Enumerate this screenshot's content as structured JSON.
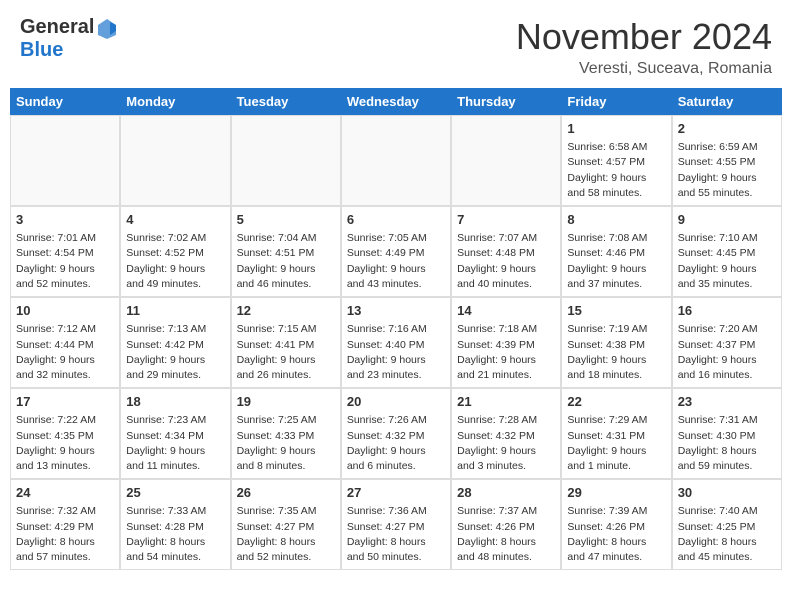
{
  "header": {
    "logo_general": "General",
    "logo_blue": "Blue",
    "month_title": "November 2024",
    "location": "Veresti, Suceava, Romania"
  },
  "calendar": {
    "days_of_week": [
      "Sunday",
      "Monday",
      "Tuesday",
      "Wednesday",
      "Thursday",
      "Friday",
      "Saturday"
    ],
    "weeks": [
      [
        {
          "day": "",
          "info": "",
          "empty": true
        },
        {
          "day": "",
          "info": "",
          "empty": true
        },
        {
          "day": "",
          "info": "",
          "empty": true
        },
        {
          "day": "",
          "info": "",
          "empty": true
        },
        {
          "day": "",
          "info": "",
          "empty": true
        },
        {
          "day": "1",
          "info": "Sunrise: 6:58 AM\nSunset: 4:57 PM\nDaylight: 9 hours and 58 minutes.",
          "empty": false
        },
        {
          "day": "2",
          "info": "Sunrise: 6:59 AM\nSunset: 4:55 PM\nDaylight: 9 hours and 55 minutes.",
          "empty": false
        }
      ],
      [
        {
          "day": "3",
          "info": "Sunrise: 7:01 AM\nSunset: 4:54 PM\nDaylight: 9 hours and 52 minutes.",
          "empty": false
        },
        {
          "day": "4",
          "info": "Sunrise: 7:02 AM\nSunset: 4:52 PM\nDaylight: 9 hours and 49 minutes.",
          "empty": false
        },
        {
          "day": "5",
          "info": "Sunrise: 7:04 AM\nSunset: 4:51 PM\nDaylight: 9 hours and 46 minutes.",
          "empty": false
        },
        {
          "day": "6",
          "info": "Sunrise: 7:05 AM\nSunset: 4:49 PM\nDaylight: 9 hours and 43 minutes.",
          "empty": false
        },
        {
          "day": "7",
          "info": "Sunrise: 7:07 AM\nSunset: 4:48 PM\nDaylight: 9 hours and 40 minutes.",
          "empty": false
        },
        {
          "day": "8",
          "info": "Sunrise: 7:08 AM\nSunset: 4:46 PM\nDaylight: 9 hours and 37 minutes.",
          "empty": false
        },
        {
          "day": "9",
          "info": "Sunrise: 7:10 AM\nSunset: 4:45 PM\nDaylight: 9 hours and 35 minutes.",
          "empty": false
        }
      ],
      [
        {
          "day": "10",
          "info": "Sunrise: 7:12 AM\nSunset: 4:44 PM\nDaylight: 9 hours and 32 minutes.",
          "empty": false
        },
        {
          "day": "11",
          "info": "Sunrise: 7:13 AM\nSunset: 4:42 PM\nDaylight: 9 hours and 29 minutes.",
          "empty": false
        },
        {
          "day": "12",
          "info": "Sunrise: 7:15 AM\nSunset: 4:41 PM\nDaylight: 9 hours and 26 minutes.",
          "empty": false
        },
        {
          "day": "13",
          "info": "Sunrise: 7:16 AM\nSunset: 4:40 PM\nDaylight: 9 hours and 23 minutes.",
          "empty": false
        },
        {
          "day": "14",
          "info": "Sunrise: 7:18 AM\nSunset: 4:39 PM\nDaylight: 9 hours and 21 minutes.",
          "empty": false
        },
        {
          "day": "15",
          "info": "Sunrise: 7:19 AM\nSunset: 4:38 PM\nDaylight: 9 hours and 18 minutes.",
          "empty": false
        },
        {
          "day": "16",
          "info": "Sunrise: 7:20 AM\nSunset: 4:37 PM\nDaylight: 9 hours and 16 minutes.",
          "empty": false
        }
      ],
      [
        {
          "day": "17",
          "info": "Sunrise: 7:22 AM\nSunset: 4:35 PM\nDaylight: 9 hours and 13 minutes.",
          "empty": false
        },
        {
          "day": "18",
          "info": "Sunrise: 7:23 AM\nSunset: 4:34 PM\nDaylight: 9 hours and 11 minutes.",
          "empty": false
        },
        {
          "day": "19",
          "info": "Sunrise: 7:25 AM\nSunset: 4:33 PM\nDaylight: 9 hours and 8 minutes.",
          "empty": false
        },
        {
          "day": "20",
          "info": "Sunrise: 7:26 AM\nSunset: 4:32 PM\nDaylight: 9 hours and 6 minutes.",
          "empty": false
        },
        {
          "day": "21",
          "info": "Sunrise: 7:28 AM\nSunset: 4:32 PM\nDaylight: 9 hours and 3 minutes.",
          "empty": false
        },
        {
          "day": "22",
          "info": "Sunrise: 7:29 AM\nSunset: 4:31 PM\nDaylight: 9 hours and 1 minute.",
          "empty": false
        },
        {
          "day": "23",
          "info": "Sunrise: 7:31 AM\nSunset: 4:30 PM\nDaylight: 8 hours and 59 minutes.",
          "empty": false
        }
      ],
      [
        {
          "day": "24",
          "info": "Sunrise: 7:32 AM\nSunset: 4:29 PM\nDaylight: 8 hours and 57 minutes.",
          "empty": false
        },
        {
          "day": "25",
          "info": "Sunrise: 7:33 AM\nSunset: 4:28 PM\nDaylight: 8 hours and 54 minutes.",
          "empty": false
        },
        {
          "day": "26",
          "info": "Sunrise: 7:35 AM\nSunset: 4:27 PM\nDaylight: 8 hours and 52 minutes.",
          "empty": false
        },
        {
          "day": "27",
          "info": "Sunrise: 7:36 AM\nSunset: 4:27 PM\nDaylight: 8 hours and 50 minutes.",
          "empty": false
        },
        {
          "day": "28",
          "info": "Sunrise: 7:37 AM\nSunset: 4:26 PM\nDaylight: 8 hours and 48 minutes.",
          "empty": false
        },
        {
          "day": "29",
          "info": "Sunrise: 7:39 AM\nSunset: 4:26 PM\nDaylight: 8 hours and 47 minutes.",
          "empty": false
        },
        {
          "day": "30",
          "info": "Sunrise: 7:40 AM\nSunset: 4:25 PM\nDaylight: 8 hours and 45 minutes.",
          "empty": false
        }
      ]
    ]
  }
}
